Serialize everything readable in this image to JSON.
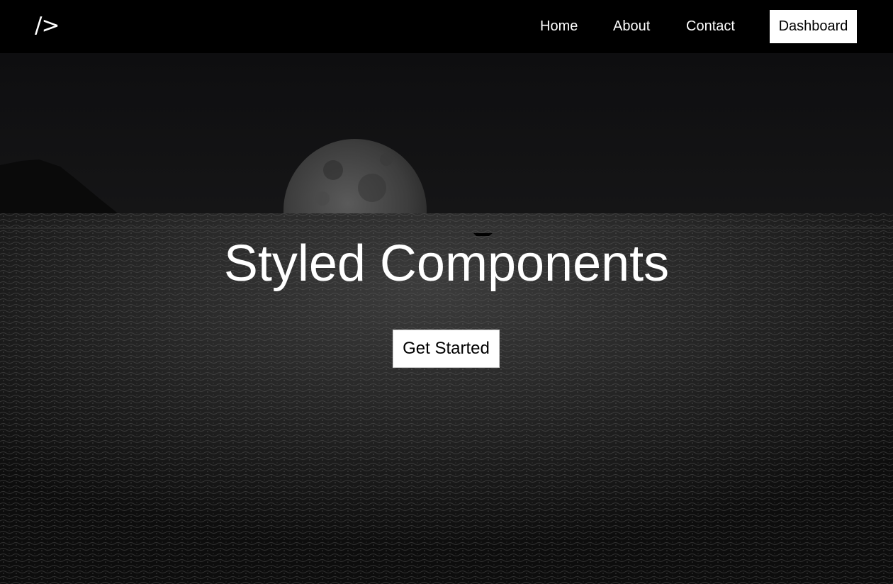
{
  "navbar": {
    "logo_text": "/>",
    "links": [
      {
        "label": "Home"
      },
      {
        "label": "About"
      },
      {
        "label": "Contact"
      }
    ],
    "dashboard_label": "Dashboard"
  },
  "hero": {
    "title": "Styled Components",
    "cta_label": "Get Started"
  },
  "colors": {
    "navbar_bg": "#000000",
    "text": "#ffffff",
    "button_bg": "#ffffff",
    "button_text": "#000000"
  }
}
